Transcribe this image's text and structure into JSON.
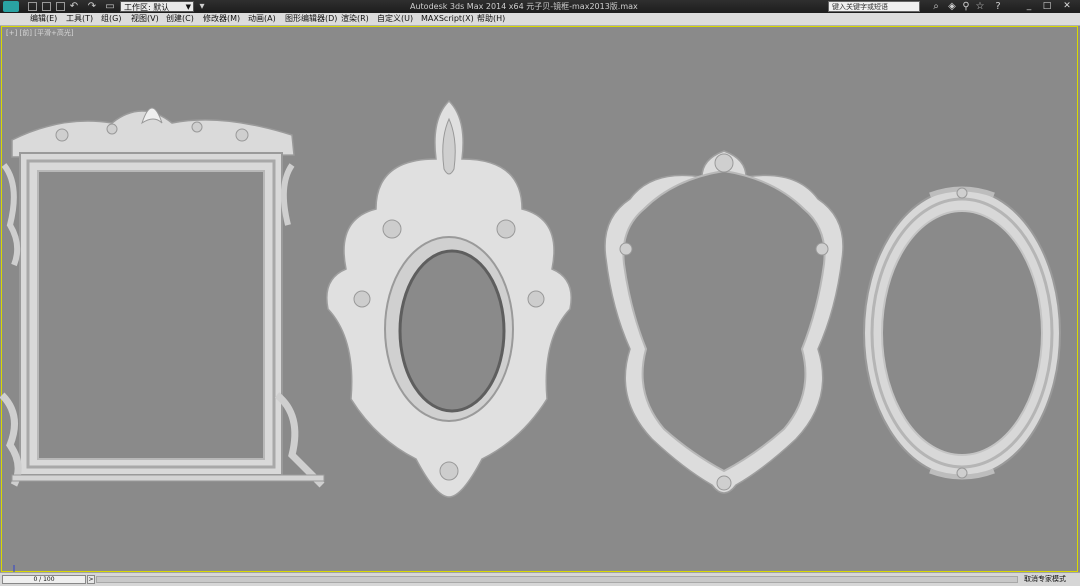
{
  "titlebar": {
    "workspace_value": "工作区: 默认",
    "title": "Autodesk 3ds Max 2014 x64    元子贝-镜框-max2013版.max",
    "search_placeholder": "键入关键字或短语"
  },
  "menubar": {
    "items": [
      "编辑(E)",
      "工具(T)",
      "组(G)",
      "视图(V)",
      "创建(C)",
      "修改器(M)",
      "动画(A)",
      "图形编辑器(D)",
      "渲染(R)",
      "自定义(U)",
      "MAXScript(X)",
      "帮助(H)"
    ]
  },
  "viewport": {
    "label": "[+] [前] [平滑+高光]",
    "frames": [
      "rectangular-mirror-frame",
      "baroque-oval-mirror-frame",
      "rococo-mirror-frame",
      "oval-mirror-frame"
    ]
  },
  "statusbar": {
    "time_slider": "0 / 100",
    "slider_next": ">",
    "status_text": "取消专家模式"
  },
  "colors": {
    "viewport_bg": "#8a8a8a",
    "viewport_border": "#d8d800",
    "frame_fill": "#e2e2e2",
    "frame_shadow": "#9c9c9c"
  }
}
